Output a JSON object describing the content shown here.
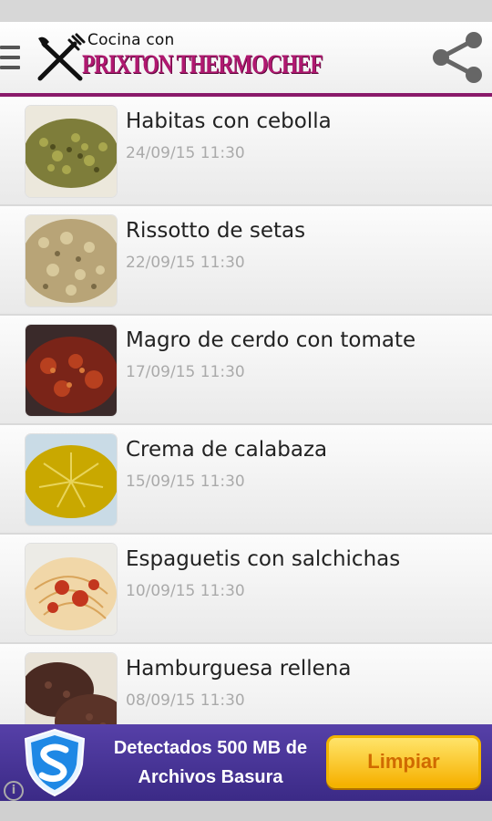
{
  "app": {
    "logo_line1": "Cocina con",
    "logo_line2": "PRIXTON THERMOCHEF"
  },
  "icons": {
    "menu": "hamburger-menu-icon",
    "logo": "fork-knife-icon",
    "share": "share-icon",
    "ad_logo": "shield-s-icon",
    "ad_info": "info-icon"
  },
  "colors": {
    "brand": "#b01870",
    "accent_line": "#8a1a6a",
    "ad_background": "#4a3598",
    "ad_button": "#f6b100"
  },
  "recipes": [
    {
      "title": "Habitas con cebolla",
      "date": "24/09/15 11:30"
    },
    {
      "title": "Rissotto de setas",
      "date": "22/09/15 11:30"
    },
    {
      "title": "Magro de cerdo con tomate",
      "date": "17/09/15 11:30"
    },
    {
      "title": "Crema de calabaza",
      "date": "15/09/15 11:30"
    },
    {
      "title": "Espaguetis con salchichas",
      "date": "10/09/15 11:30"
    },
    {
      "title": "Hamburguesa rellena",
      "date": "08/09/15 11:30"
    }
  ],
  "ad": {
    "message": "Detectados 500 MB de Archivos Basura",
    "button_label": "Limpiar",
    "info_label": "i"
  }
}
